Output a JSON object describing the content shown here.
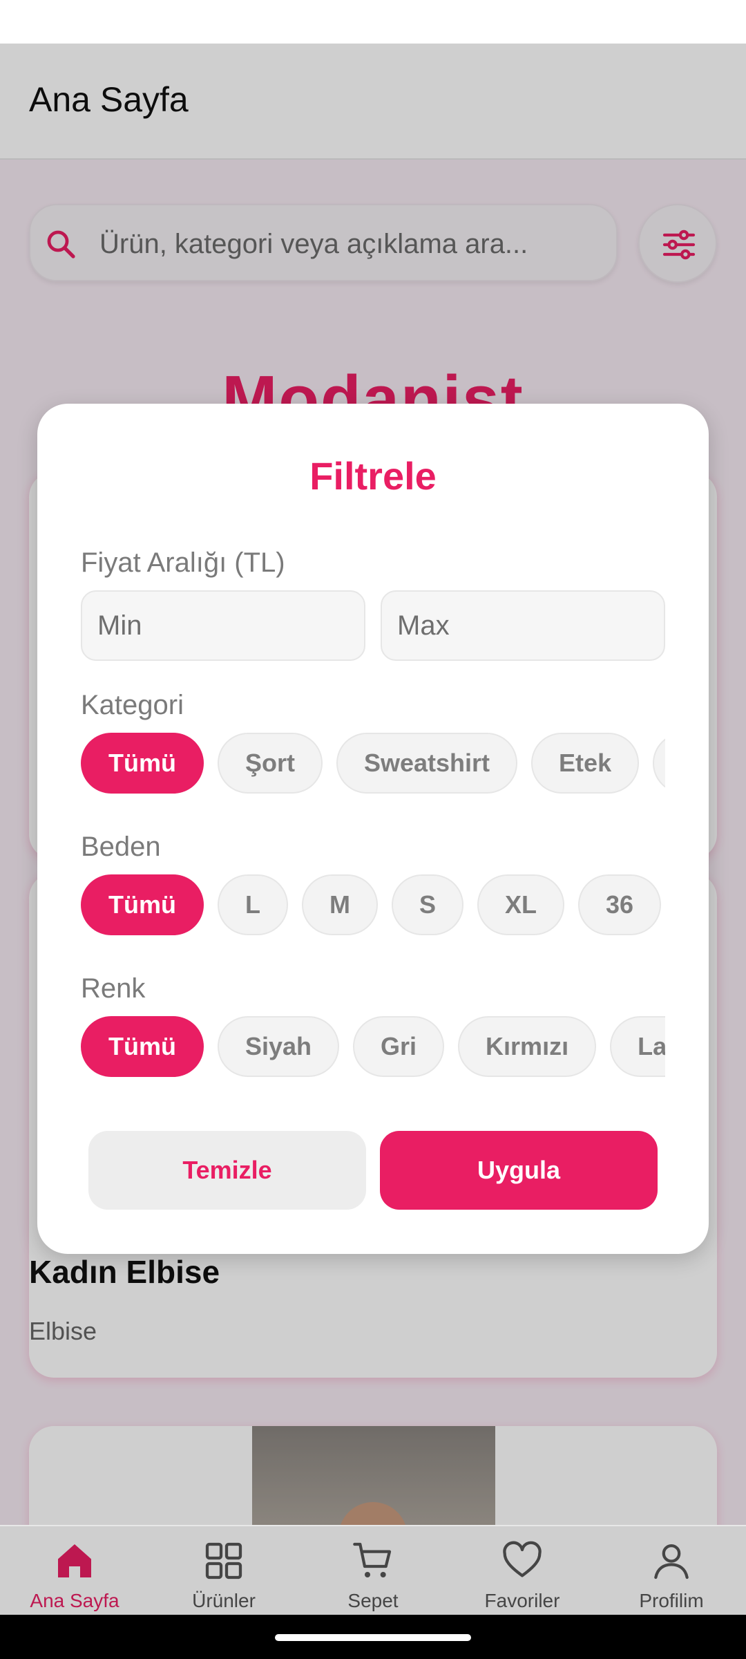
{
  "appbar": {
    "title": "Ana Sayfa"
  },
  "search": {
    "placeholder": "Ürün, kategori veya açıklama ara..."
  },
  "brand": {
    "title": "Modanist"
  },
  "product_card": {
    "title": "Kadın Elbise",
    "category": "Elbise"
  },
  "filter_modal": {
    "title": "Filtrele",
    "price": {
      "label": "Fiyat Aralığı (TL)",
      "min_placeholder": "Min",
      "max_placeholder": "Max"
    },
    "category": {
      "label": "Kategori",
      "options": [
        "Tümü",
        "Şort",
        "Sweatshirt",
        "Etek",
        ""
      ],
      "selected": "Tümü"
    },
    "size": {
      "label": "Beden",
      "options": [
        "Tümü",
        "L",
        "M",
        "S",
        "XL",
        "36"
      ],
      "selected": "Tümü"
    },
    "color": {
      "label": "Renk",
      "options": [
        "Tümü",
        "Siyah",
        "Gri",
        "Kırmızı",
        "Lac"
      ],
      "selected": "Tümü"
    },
    "clear_label": "Temizle",
    "apply_label": "Uygula"
  },
  "bottom_nav": {
    "items": [
      {
        "label": "Ana Sayfa",
        "icon": "home-icon",
        "active": true
      },
      {
        "label": "Ürünler",
        "icon": "grid-icon",
        "active": false
      },
      {
        "label": "Sepet",
        "icon": "cart-icon",
        "active": false
      },
      {
        "label": "Favoriler",
        "icon": "heart-icon",
        "active": false
      },
      {
        "label": "Profilim",
        "icon": "profile-icon",
        "active": false
      }
    ]
  },
  "colors": {
    "accent": "#e91e63",
    "chip_bg": "#f3f3f3",
    "scrim": "rgba(0,0,0,0.19)"
  }
}
